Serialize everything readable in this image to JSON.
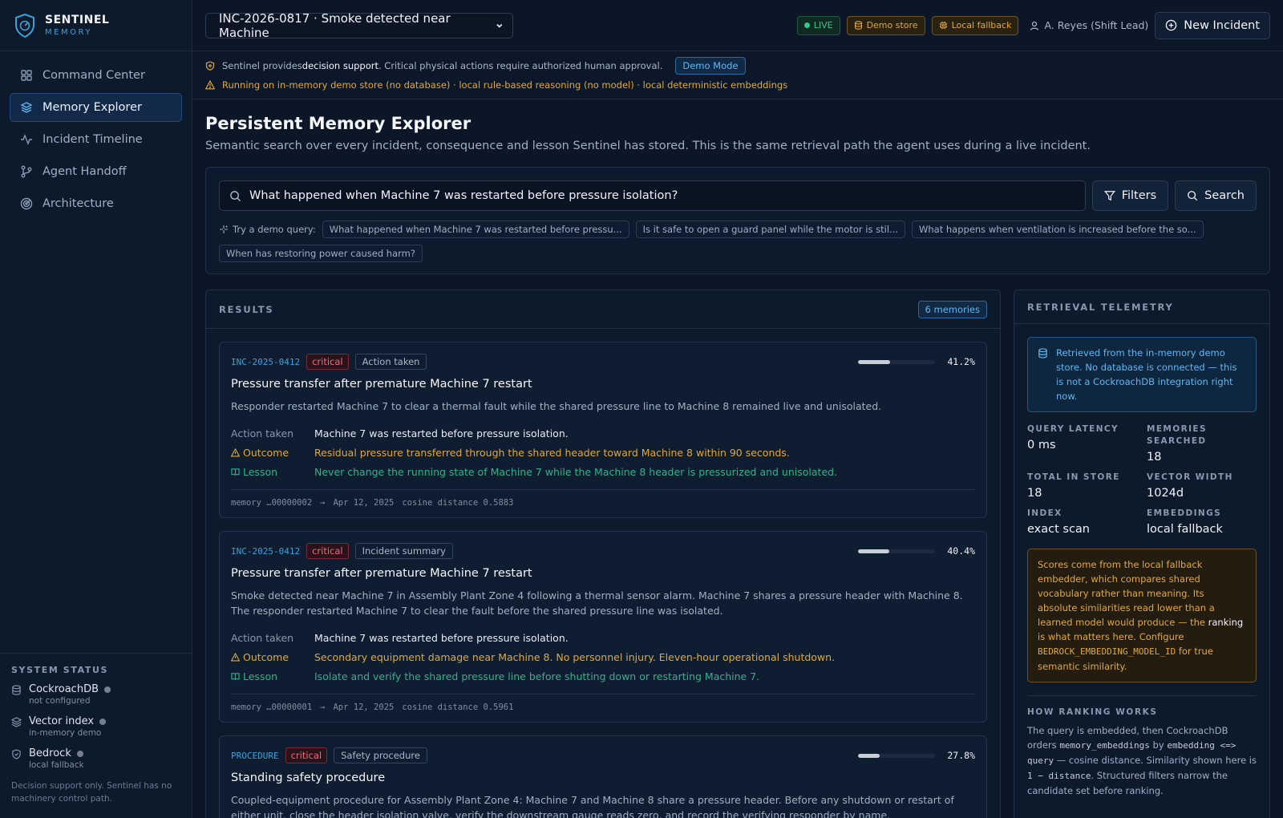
{
  "app": {
    "brand_name": "SENTINEL",
    "brand_sub": "MEMORY",
    "accent": "#3aa0d8"
  },
  "sidebar": {
    "items": [
      {
        "label": "Command Center",
        "icon": "grid-icon",
        "active": false
      },
      {
        "label": "Memory Explorer",
        "icon": "layers-icon",
        "active": true
      },
      {
        "label": "Incident Timeline",
        "icon": "activity-icon",
        "active": false
      },
      {
        "label": "Agent Handoff",
        "icon": "branch-icon",
        "active": false
      },
      {
        "label": "Architecture",
        "icon": "radar-icon",
        "active": false
      }
    ],
    "status_title": "SYSTEM STATUS",
    "status": [
      {
        "name": "CockroachDB",
        "sub": "not configured",
        "icon": "database-icon"
      },
      {
        "name": "Vector index",
        "sub": "in-memory demo",
        "icon": "layers-icon"
      },
      {
        "name": "Bedrock",
        "sub": "local fallback",
        "icon": "shield-icon"
      }
    ],
    "note": "Decision support only. Sentinel has no machinery control path."
  },
  "topbar": {
    "incident": "INC-2026-0817 · Smoke detected near Machine",
    "live": "LIVE",
    "demo_store": "Demo store",
    "local_fallback": "Local fallback",
    "user": "A. Reyes (Shift Lead)",
    "new_incident": "New Incident"
  },
  "banner": {
    "line1_pre": "Sentinel provides ",
    "line1_strong": "decision support",
    "line1_post": ". Critical physical actions require authorized human approval.",
    "demo_mode": "Demo Mode",
    "line2": "Running on in-memory demo store (no database) · local rule-based reasoning (no model) · local deterministic embeddings"
  },
  "page": {
    "title": "Persistent Memory Explorer",
    "subtitle": "Semantic search over every incident, consequence and lesson Sentinel has stored. This is the same retrieval path the agent uses during a live incident."
  },
  "search": {
    "query": "What happened when Machine 7 was restarted before pressure isolation?",
    "filters_label": "Filters",
    "search_label": "Search",
    "demo_label": "Try a demo query:",
    "demo_queries": [
      "What happened when Machine 7 was restarted before pressu...",
      "Is it safe to open a guard panel while the motor is stil...",
      "What happens when ventilation is increased before the so...",
      "When has restoring power caused harm?"
    ]
  },
  "results": {
    "title": "RESULTS",
    "count": "6 memories",
    "labels": {
      "action": "Action taken",
      "outcome": "Outcome",
      "lesson": "Lesson"
    },
    "items": [
      {
        "id": "INC-2025-0412",
        "severity": "critical",
        "kind": "Action taken",
        "score": "41.2%",
        "score_fraction": 0.412,
        "title": "Pressure transfer after premature Machine 7 restart",
        "summary": "Responder restarted Machine 7 to clear a thermal fault while the shared pressure line to Machine 8 remained live and unisolated.",
        "action": "Machine 7 was restarted before pressure isolation.",
        "outcome": "Residual pressure transferred through the shared header toward Machine 8 within 90 seconds.",
        "lesson": "Never change the running state of Machine 7 while the Machine 8 header is pressurized and unisolated.",
        "memory": "memory …00000002",
        "date": "Apr 12, 2025",
        "distance": "cosine distance 0.5883"
      },
      {
        "id": "INC-2025-0412",
        "severity": "critical",
        "kind": "Incident summary",
        "score": "40.4%",
        "score_fraction": 0.404,
        "title": "Pressure transfer after premature Machine 7 restart",
        "summary": "Smoke detected near Machine 7 in Assembly Plant Zone 4 following a thermal sensor alarm. Machine 7 shares a pressure header with Machine 8. The responder restarted Machine 7 to clear the fault before the shared pressure line was isolated.",
        "action": "Machine 7 was restarted before pressure isolation.",
        "outcome": "Secondary equipment damage near Machine 8. No personnel injury. Eleven-hour operational shutdown.",
        "lesson": "Isolate and verify the shared pressure line before shutting down or restarting Machine 7.",
        "memory": "memory …00000001",
        "date": "Apr 12, 2025",
        "distance": "cosine distance 0.5961"
      },
      {
        "id": "PROCEDURE",
        "severity": "critical",
        "kind": "Safety procedure",
        "score": "27.8%",
        "score_fraction": 0.278,
        "title": "Standing safety procedure",
        "summary": "Coupled-equipment procedure for Assembly Plant Zone 4: Machine 7 and Machine 8 share a pressure header. Before any shutdown or restart of either unit, close the header isolation valve, verify the downstream gauge reads zero, and record the verifying responder by name."
      }
    ]
  },
  "telemetry": {
    "title": "RETRIEVAL TELEMETRY",
    "info": "Retrieved from the in-memory demo store. No database is connected — this is not a CockroachDB integration right now.",
    "stats": [
      {
        "label": "QUERY LATENCY",
        "value": "0 ms"
      },
      {
        "label": "MEMORIES SEARCHED",
        "value": "18"
      },
      {
        "label": "TOTAL IN STORE",
        "value": "18"
      },
      {
        "label": "VECTOR WIDTH",
        "value": "1024d"
      },
      {
        "label": "INDEX",
        "value": "exact scan"
      },
      {
        "label": "EMBEDDINGS",
        "value": "local fallback"
      }
    ],
    "warn_pre": "Scores come from the local fallback embedder, which compares shared vocabulary rather than meaning. Its absolute similarities read lower than a learned model would produce — the ",
    "warn_strong": "ranking",
    "warn_mid": " is what matters here. Configure ",
    "warn_code": "BEDROCK_EMBEDDING_MODEL_ID",
    "warn_post": " for true semantic similarity.",
    "how_title": "HOW RANKING WORKS",
    "how_1": "The query is embedded, then CockroachDB orders ",
    "how_code1": "memory_embeddings",
    "how_2": " by ",
    "how_code2": "embedding <=> query",
    "how_3": " — cosine distance. Similarity shown here is ",
    "how_code3": "1 − distance",
    "how_4": ". Structured filters narrow the candidate set before ranking."
  }
}
